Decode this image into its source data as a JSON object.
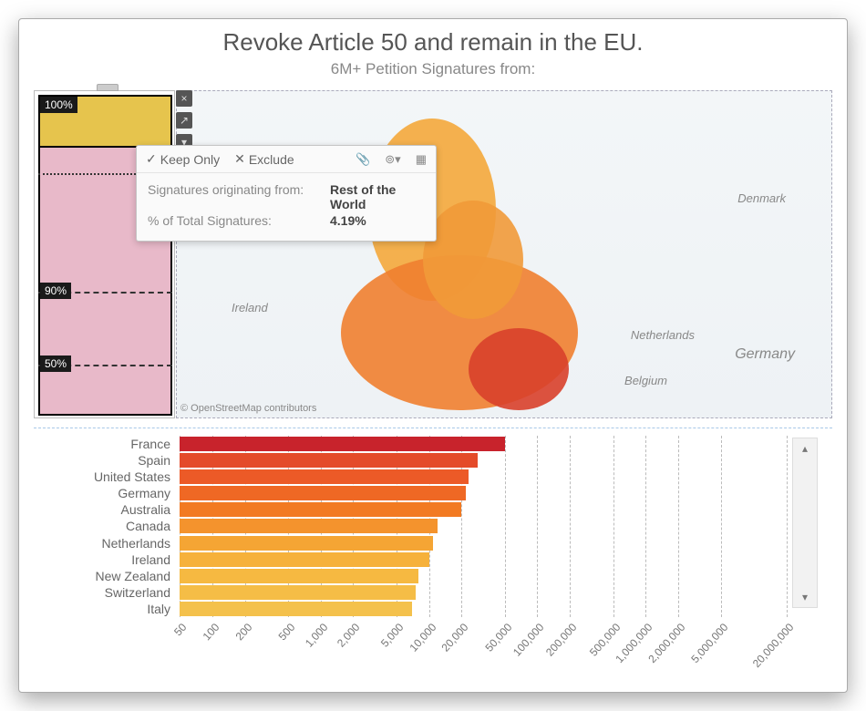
{
  "title": "Revoke Article 50 and remain in the EU.",
  "subtitle": "6M+ Petition Signatures from:",
  "gauge": {
    "labels": {
      "p100": "100%",
      "p90": "90%",
      "p50": "50%"
    }
  },
  "side_icons": {
    "close": "×",
    "share": "↗",
    "filter": "▾"
  },
  "map": {
    "labels": {
      "ireland": "Ireland",
      "netherlands": "Netherlands",
      "belgium": "Belgium",
      "germany": "Germany",
      "denmark": "Denmark"
    },
    "attribution": "© OpenStreetMap contributors"
  },
  "tooltip": {
    "keep": "Keep Only",
    "exclude": "Exclude",
    "rows": [
      {
        "label": "Signatures originating from:",
        "value": "Rest of the World"
      },
      {
        "label": "% of Total Signatures:",
        "value": "4.19%"
      }
    ]
  },
  "chart_data": {
    "type": "bar",
    "title": "",
    "xlabel": "",
    "ylabel": "",
    "scale": "log",
    "xticks": [
      "50",
      "100",
      "200",
      "500",
      "1,000",
      "2,000",
      "5,000",
      "10,000",
      "20,000",
      "50,000",
      "100,000",
      "200,000",
      "500,000",
      "1,000,000",
      "2,000,000",
      "5,000,000",
      "20,000,000"
    ],
    "series": [
      {
        "name": "France",
        "value": 50000,
        "color": "#c8232c"
      },
      {
        "name": "Spain",
        "value": 28000,
        "color": "#e44b2a"
      },
      {
        "name": "United States",
        "value": 23000,
        "color": "#ec5a27"
      },
      {
        "name": "Germany",
        "value": 22000,
        "color": "#ef6824"
      },
      {
        "name": "Australia",
        "value": 20000,
        "color": "#f27a22"
      },
      {
        "name": "Canada",
        "value": 12000,
        "color": "#f4932d"
      },
      {
        "name": "Netherlands",
        "value": 11000,
        "color": "#f5a534"
      },
      {
        "name": "Ireland",
        "value": 10000,
        "color": "#f6b13b"
      },
      {
        "name": "New Zealand",
        "value": 8000,
        "color": "#f6b941"
      },
      {
        "name": "Switzerland",
        "value": 7500,
        "color": "#f5bd46"
      },
      {
        "name": "Italy",
        "value": 7000,
        "color": "#f4c14c"
      }
    ]
  },
  "scroll": {
    "up": "▴",
    "down": "▾"
  }
}
